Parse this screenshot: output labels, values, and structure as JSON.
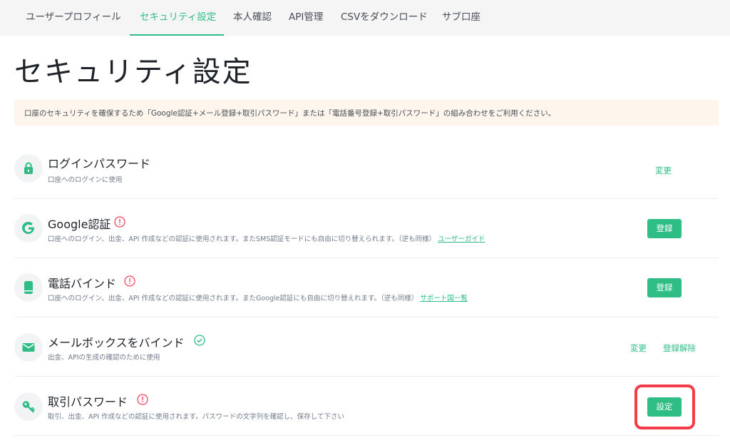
{
  "tabs": [
    {
      "label": "ユーザープロフィール"
    },
    {
      "label": "セキュリティ設定"
    },
    {
      "label": "本人確認"
    },
    {
      "label": "API管理"
    },
    {
      "label": "CSVをダウンロード"
    },
    {
      "label": "サブ口座"
    }
  ],
  "active_tab": "セキュリティ設定",
  "page_title": "セキュリティ設定",
  "notice": "口座のセキュリティを確保するため「Google認証+メール登録+取引パスワード」または「電話番号登録+取引パスワード」の組み合わせをご利用ください。",
  "colors": {
    "accent": "#2ebd85",
    "warning": "#f6465d",
    "highlight": "#f23c48",
    "notice_bg": "#fef6ec"
  },
  "items": [
    {
      "icon": "lock-icon",
      "title": "ログインパスワード",
      "desc": "口座へのログインに使用",
      "status": "none",
      "action": "変更"
    },
    {
      "icon": "google-icon",
      "title": "Google認証",
      "desc": "口座へのログイン、出金、API 作成などの認証に使用されます。またSMS認証モードにも自由に切り替えられます。（逆も同様）",
      "link": "ユーザーガイド",
      "status": "warning",
      "button": "登録"
    },
    {
      "icon": "phone-icon",
      "title": "電話バインド",
      "desc": "口座へのログイン、出金、API 作成などの認証に使用されます。またGoogle認証にも自由に切り替えれます。（逆も同様）",
      "link": "サポート国一覧",
      "status": "warning",
      "button": "登録"
    },
    {
      "icon": "mail-icon",
      "title": "メールボックスをバインド",
      "desc": "出金、APIの生成の確認のために使用",
      "status": "verified",
      "action": "変更",
      "action2": "登録解除"
    },
    {
      "icon": "key-icon",
      "title": "取引パスワード",
      "desc": "取引、出金、API 作成などの認証に使用されます。パスワードの文字列を確認し、保存して下さい",
      "status": "warning",
      "button": "設定"
    }
  ]
}
